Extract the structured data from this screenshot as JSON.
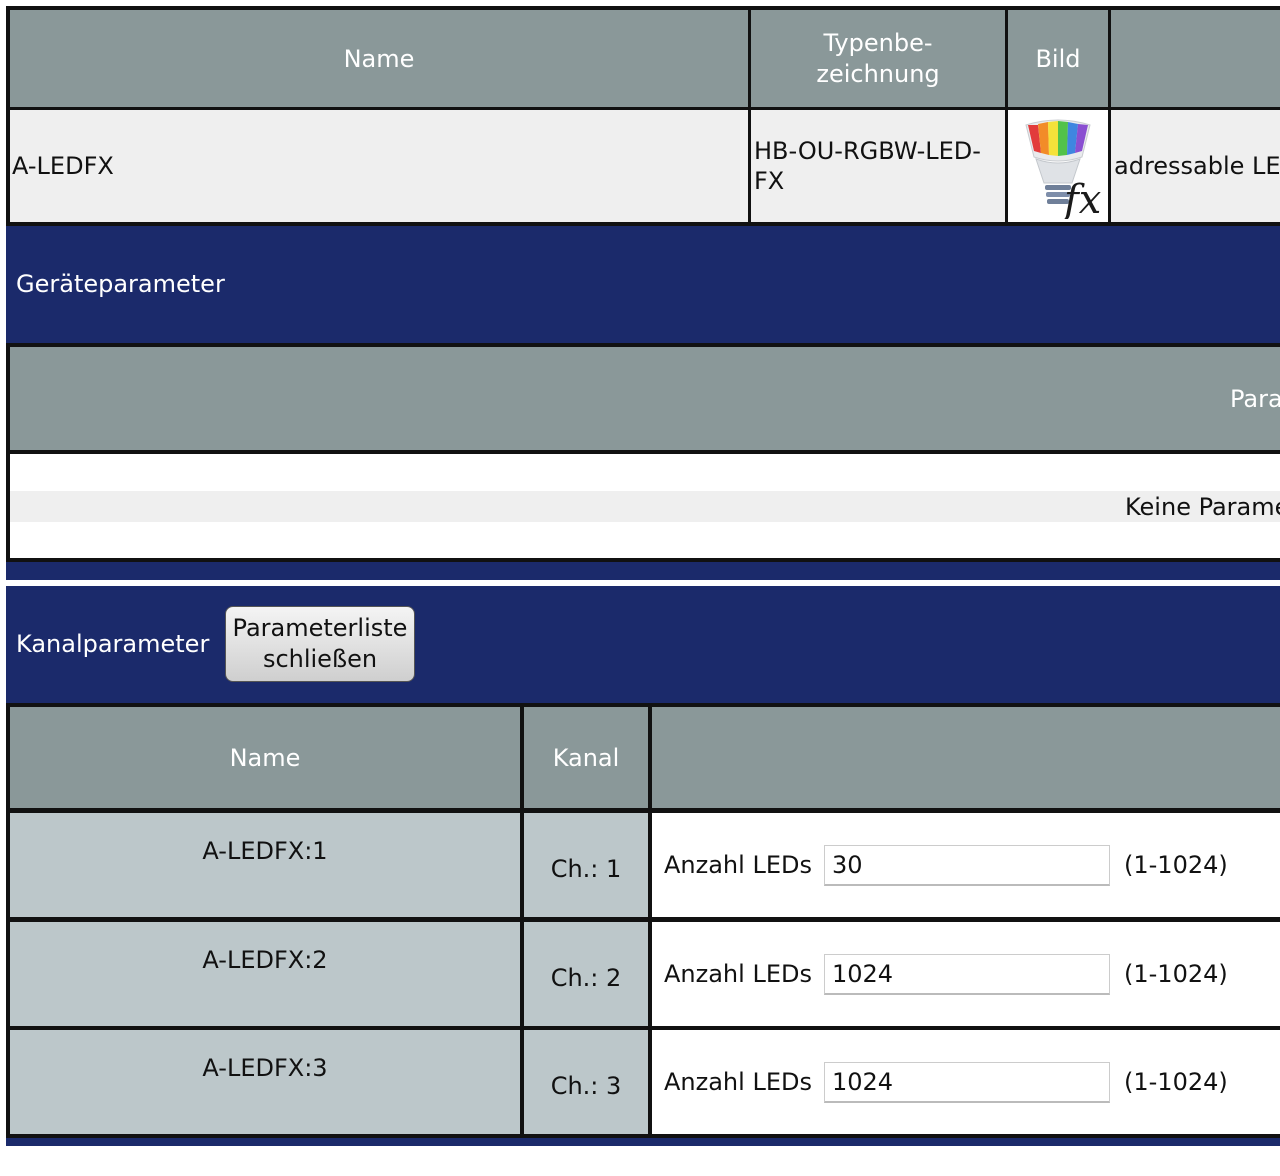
{
  "device_table": {
    "headers": {
      "name": "Name",
      "type_line1": "Typenbe-",
      "type_line2": "zeichnung",
      "image": "Bild"
    },
    "row": {
      "name": "A-LEDFX",
      "type_line1": "HB-OU-RGBW-LED-",
      "type_line2": "FX",
      "description": "adressable LE"
    }
  },
  "device_params": {
    "title": "Geräteparameter",
    "header_fragment": "Para",
    "empty_text": "Keine Parame"
  },
  "channel_params": {
    "title": "Kanalparameter",
    "close_button_line1": "Parameterliste",
    "close_button_line2": "schließen",
    "headers": {
      "name": "Name",
      "kanal": "Kanal"
    },
    "rows": [
      {
        "name": "A-LEDFX:1",
        "kanal": "Ch.: 1",
        "label": "Anzahl LEDs",
        "value": "30",
        "range": "(1-1024)"
      },
      {
        "name": "A-LEDFX:2",
        "kanal": "Ch.: 2",
        "label": "Anzahl LEDs",
        "value": "1024",
        "range": "(1-1024)"
      },
      {
        "name": "A-LEDFX:3",
        "kanal": "Ch.: 3",
        "label": "Anzahl LEDs",
        "value": "1024",
        "range": "(1-1024)"
      }
    ]
  },
  "colors": {
    "header_gray": "#8a9899",
    "band_navy": "#1b2a6b",
    "row_light": "#efefef",
    "channel_cell": "#bcc7ca"
  },
  "icons": {
    "device_image": "rgb-bulb-fx-icon"
  }
}
